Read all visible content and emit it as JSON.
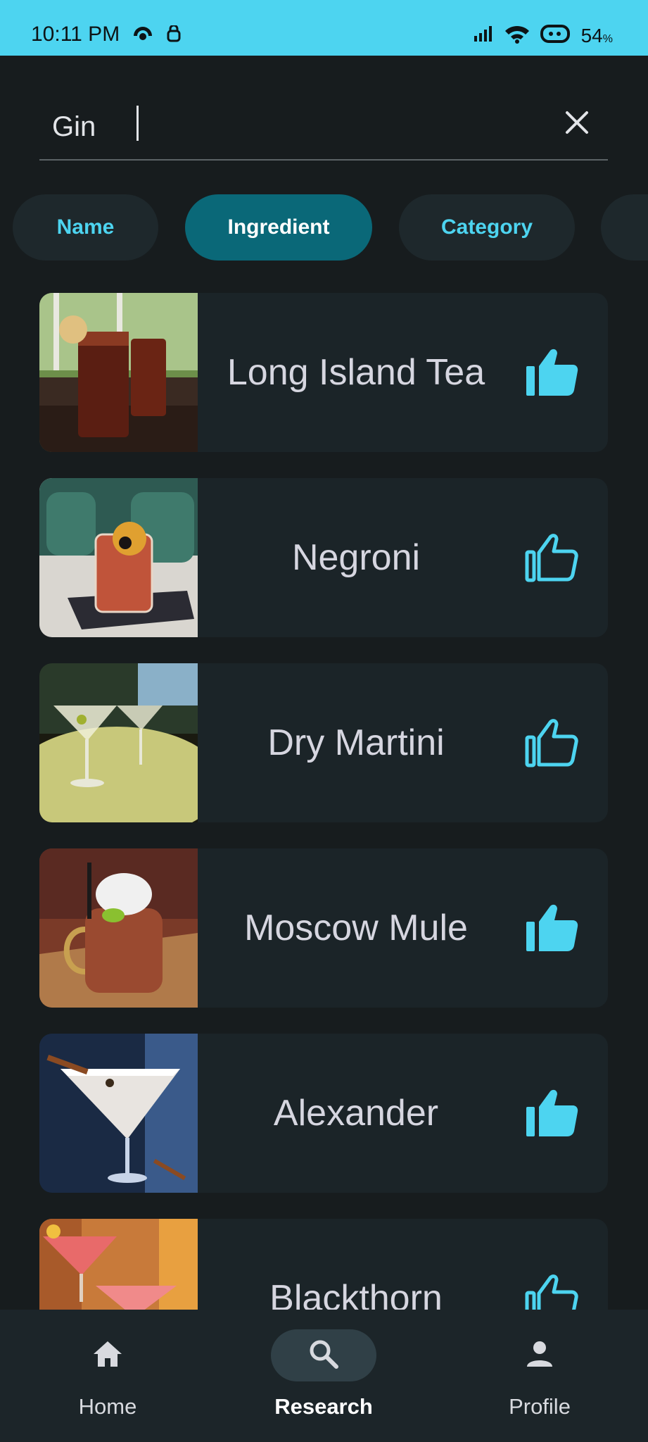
{
  "status_bar": {
    "time": "10:11 PM",
    "battery": "54",
    "battery_unit": "%",
    "icons": [
      "hotspot-icon",
      "vpn-icon",
      "signal-icon",
      "wifi-icon",
      "battery-icon"
    ]
  },
  "search": {
    "value": "Gin",
    "clear_icon": "close-icon"
  },
  "filters": {
    "chips": [
      {
        "label": "Name",
        "active": false
      },
      {
        "label": "Ingredient",
        "active": true
      },
      {
        "label": "Category",
        "active": false
      },
      {
        "label": "",
        "active": false
      }
    ]
  },
  "results": [
    {
      "name": "Long Island Tea",
      "liked": true
    },
    {
      "name": "Negroni",
      "liked": false
    },
    {
      "name": "Dry Martini",
      "liked": false
    },
    {
      "name": "Moscow Mule",
      "liked": true
    },
    {
      "name": "Alexander",
      "liked": true
    },
    {
      "name": "Blackthorn",
      "liked": false
    }
  ],
  "bottom_nav": {
    "items": [
      {
        "label": "Home",
        "icon": "home-icon",
        "active": false
      },
      {
        "label": "Research",
        "icon": "search-icon",
        "active": true
      },
      {
        "label": "Profile",
        "icon": "person-icon",
        "active": false
      }
    ]
  },
  "colors": {
    "accent": "#4dd4f0",
    "active_chip": "#0a6878",
    "background": "#171c1e",
    "card": "#1b2428"
  }
}
